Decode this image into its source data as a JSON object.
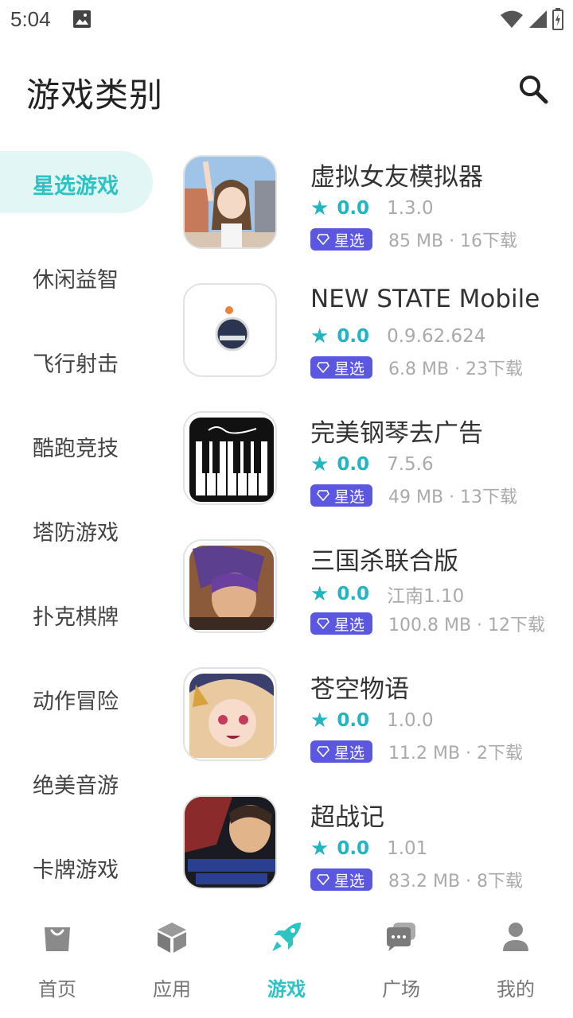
{
  "status_bar": {
    "time": "5:04"
  },
  "header": {
    "title": "游戏类别"
  },
  "sidebar": {
    "items": [
      {
        "label": "星选游戏",
        "active": true
      },
      {
        "label": "休闲益智"
      },
      {
        "label": "飞行射击"
      },
      {
        "label": "酷跑竞技"
      },
      {
        "label": "塔防游戏"
      },
      {
        "label": "扑克棋牌"
      },
      {
        "label": "动作冒险"
      },
      {
        "label": "绝美音游"
      },
      {
        "label": "卡牌游戏"
      }
    ]
  },
  "games": [
    {
      "name": "虚拟女友模拟器",
      "rating": "0.0",
      "version": "1.3.0",
      "badge": "星选",
      "info": "85 MB · 16下载",
      "icon": "anime-girl-icon"
    },
    {
      "name": "NEW STATE Mobile",
      "rating": "0.0",
      "version": "0.9.62.624",
      "badge": "星选",
      "info": "6.8 MB · 23下载",
      "icon": "new-state-icon"
    },
    {
      "name": "完美钢琴去广告",
      "rating": "0.0",
      "version": "7.5.6",
      "badge": "星选",
      "info": "49 MB · 13下载",
      "icon": "piano-icon"
    },
    {
      "name": "三国杀联合版",
      "rating": "0.0",
      "version": "江南1.10",
      "badge": "星选",
      "info": "100.8 MB · 12下载",
      "icon": "sanguosha-icon"
    },
    {
      "name": "苍空物语",
      "rating": "0.0",
      "version": "1.0.0",
      "badge": "星选",
      "info": "11.2 MB · 2下载",
      "icon": "anime-character-icon"
    },
    {
      "name": "超战记",
      "rating": "0.0",
      "version": "1.01",
      "badge": "星选",
      "info": "83.2 MB · 8下载",
      "icon": "ultra-battle-icon"
    }
  ],
  "bottom_nav": {
    "items": [
      {
        "label": "首页",
        "icon": "bag-icon"
      },
      {
        "label": "应用",
        "icon": "cube-icon"
      },
      {
        "label": "游戏",
        "icon": "rocket-icon",
        "active": true
      },
      {
        "label": "广场",
        "icon": "chat-icon"
      },
      {
        "label": "我的",
        "icon": "person-icon"
      }
    ]
  },
  "colors": {
    "accent": "#2ec3c3",
    "star": "#20b5bf",
    "badge": "#5b57e0"
  }
}
